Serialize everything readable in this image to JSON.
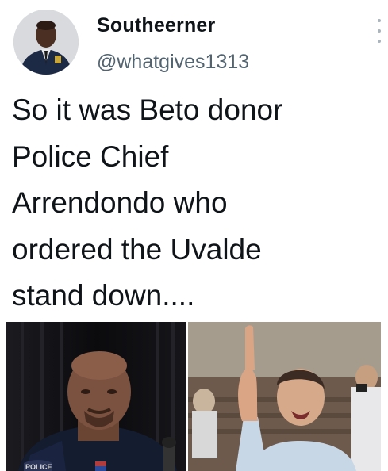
{
  "tweet": {
    "author": {
      "display_name": "Southeerner",
      "handle": "@whatgives1313",
      "avatar_icon": "profile-avatar-icon"
    },
    "more_icon": "more-options-icon",
    "text_lines": [
      "So it was Beto donor",
      "Police Chief",
      "Arrendondo who",
      "ordered the Uvalde",
      "stand down...."
    ],
    "media": {
      "left_photo_caption_visible": "POLICE"
    }
  }
}
